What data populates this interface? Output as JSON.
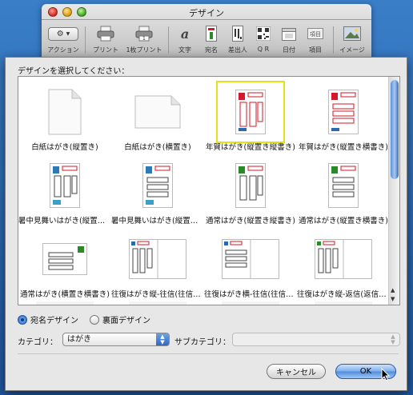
{
  "window": {
    "title": "デザイン",
    "toolbar": [
      {
        "label": "アクション",
        "icon": "gear-icon"
      },
      {
        "label": "プリント",
        "icon": "printer-icon"
      },
      {
        "label": "1枚プリント",
        "icon": "printer-single-icon"
      },
      {
        "label": "文字",
        "icon": "text-icon"
      },
      {
        "label": "宛名",
        "icon": "address-icon"
      },
      {
        "label": "差出人",
        "icon": "sender-icon"
      },
      {
        "label": "Q R",
        "icon": "qr-code-icon"
      },
      {
        "label": "日付",
        "icon": "calendar-icon"
      },
      {
        "label": "項目",
        "icon": "field-icon"
      },
      {
        "label": "イメージ",
        "icon": "image-icon"
      }
    ]
  },
  "dialog": {
    "prompt": "デザインを選択してください：",
    "designs": [
      {
        "label": "白紙はがき(縦置き)",
        "kind": "blank-tall"
      },
      {
        "label": "白紙はがき(横置き)",
        "kind": "blank-wide"
      },
      {
        "label": "年賀はがき(縦置き縦書き)",
        "kind": "nenga-v",
        "selected": true
      },
      {
        "label": "年賀はがき(縦置き横書き)",
        "kind": "nenga-h"
      },
      {
        "label": "暑中見舞いはがき(縦置き…",
        "kind": "summer-v"
      },
      {
        "label": "暑中見舞いはがき(縦置き…",
        "kind": "summer-h"
      },
      {
        "label": "通常はがき(縦置き縦書き)",
        "kind": "normal-v"
      },
      {
        "label": "通常はがき(縦置き横書き)",
        "kind": "normal-h"
      },
      {
        "label": "通常はがき(横置き横書き)",
        "kind": "normal-wide"
      },
      {
        "label": "往復はがき縦-往信(往信表…",
        "kind": "reply-1"
      },
      {
        "label": "往復はがき横-往信(往信表…",
        "kind": "reply-2"
      },
      {
        "label": "往復はがき縦-返信(返信表…",
        "kind": "reply-3"
      }
    ],
    "face_options": [
      {
        "label": "宛名デザイン",
        "checked": true
      },
      {
        "label": "裏面デザイン",
        "checked": false
      }
    ],
    "category_label": "カテゴリ：",
    "category_value": "はがき",
    "subcategory_label": "サブカテゴリ：",
    "subcategory_value": "",
    "cancel_label": "キャンセル",
    "ok_label": "OK",
    "accent_color": "#3a7ad8",
    "selection_color": "#e2e21a",
    "stamp_color": "#d21a2a"
  }
}
